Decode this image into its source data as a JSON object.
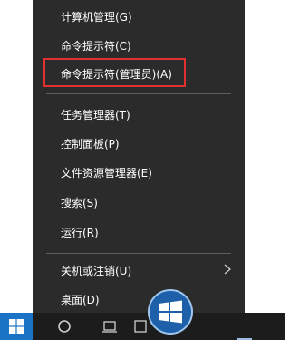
{
  "menu": {
    "items": [
      {
        "label": "计算机管理(G)"
      },
      {
        "label": "命令提示符(C)"
      },
      {
        "label": "命令提示符(管理员)(A)"
      },
      {
        "label": "任务管理器(T)"
      },
      {
        "label": "控制面板(P)"
      },
      {
        "label": "文件资源管理器(E)"
      },
      {
        "label": "搜索(S)"
      },
      {
        "label": "运行(R)"
      },
      {
        "label": "关机或注销(U)"
      },
      {
        "label": "桌面(D)"
      }
    ],
    "highlighted_item": "命令提示符(管理员)(A)",
    "highlight_color": "#e03030",
    "background_color": "#2b2b2b"
  },
  "taskbar": {
    "accent_color": "#1a73c5",
    "icons": [
      "windows-start-icon",
      "search-circle-icon",
      "task-view-icon",
      "store-icon"
    ]
  },
  "watermark": {
    "logo_icon": "windows-logo-icon"
  }
}
